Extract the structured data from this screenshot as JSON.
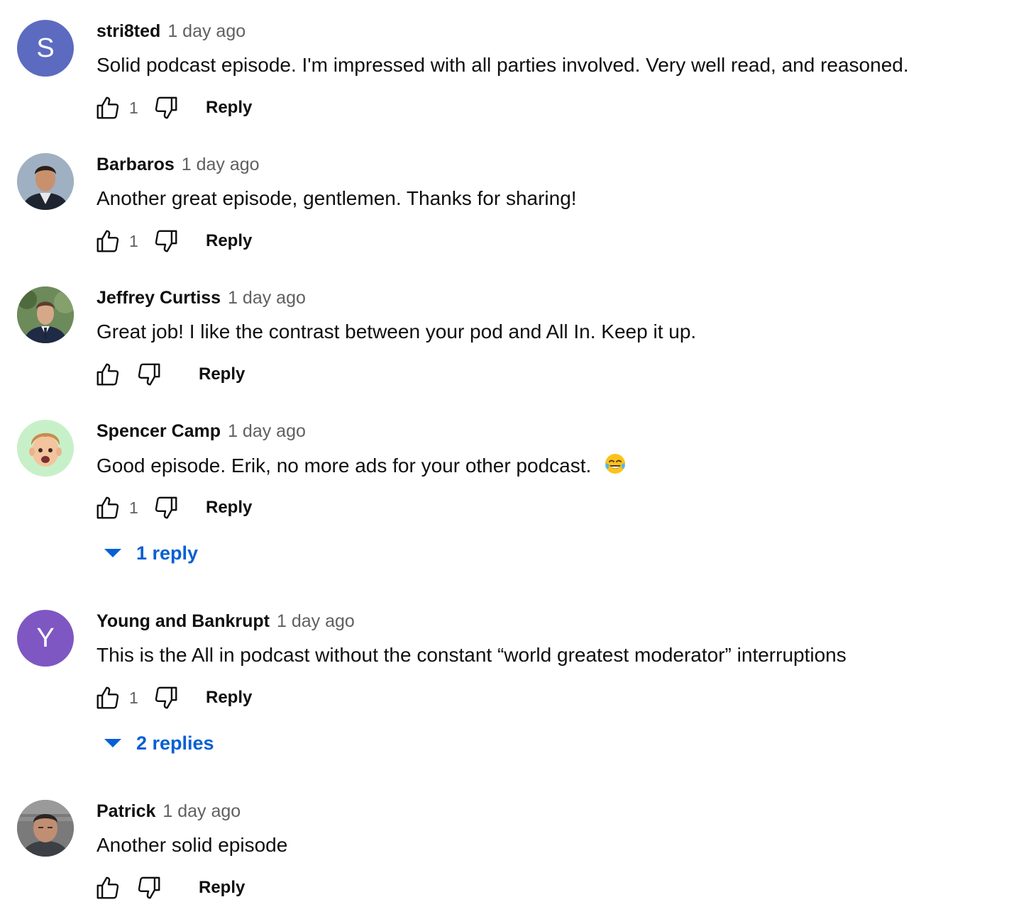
{
  "comments": [
    {
      "author": "stri8ted",
      "time": "1 day ago",
      "text": "Solid podcast episode. I'm impressed with all parties involved. Very well read, and reasoned.",
      "avatar": {
        "type": "letter",
        "letter": "S",
        "color": "#5c6bc0"
      },
      "likes": "1",
      "reply_label": "Reply"
    },
    {
      "author": "Barbaros",
      "time": "1 day ago",
      "text": "Another great episode, gentlemen. Thanks for sharing!",
      "avatar": {
        "type": "photo"
      },
      "likes": "1",
      "reply_label": "Reply"
    },
    {
      "author": "Jeffrey Curtiss",
      "time": "1 day ago",
      "text": "Great job! I like the contrast between your pod and All In. Keep it up.",
      "avatar": {
        "type": "photo"
      },
      "likes": "",
      "reply_label": "Reply"
    },
    {
      "author": "Spencer Camp",
      "time": "1 day ago",
      "text": "Good episode. Erik, no more ads for your other podcast.",
      "emoji": "face-with-tears-of-joy-emoji",
      "avatar": {
        "type": "memoji",
        "color": "#c8f0c8"
      },
      "likes": "1",
      "reply_label": "Reply",
      "replies_label": "1 reply"
    },
    {
      "author": "Young and Bankrupt",
      "time": "1 day ago",
      "text": "This is the All in podcast without the constant “world greatest moderator” interruptions",
      "avatar": {
        "type": "letter",
        "letter": "Y",
        "color": "#7e57c2"
      },
      "likes": "1",
      "reply_label": "Reply",
      "replies_label": "2 replies"
    },
    {
      "author": "Patrick",
      "time": "1 day ago",
      "text": "Another solid episode",
      "avatar": {
        "type": "photo"
      },
      "likes": "",
      "reply_label": "Reply"
    }
  ],
  "icons": {
    "like": "thumbs-up-icon",
    "dislike": "thumbs-down-icon",
    "toggle": "caret-down-icon"
  },
  "colors": {
    "link_blue": "#065fd4",
    "secondary_text": "#606060"
  }
}
